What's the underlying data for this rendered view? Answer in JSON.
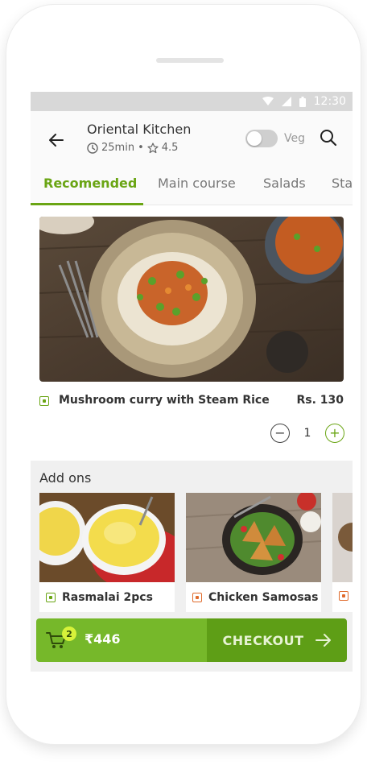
{
  "status_bar": {
    "time": "12:30"
  },
  "header": {
    "restaurant_name": "Oriental Kitchen",
    "delivery_time": "25min",
    "separator": "•",
    "rating": "4.5",
    "veg_toggle_label": "Veg"
  },
  "tabs": [
    {
      "label": "Recomended",
      "active": true
    },
    {
      "label": "Main course",
      "active": false
    },
    {
      "label": "Salads",
      "active": false
    },
    {
      "label": "Starters",
      "active": false
    }
  ],
  "featured_item": {
    "name": "Mushroom curry with Steam Rice",
    "price": "Rs. 130",
    "quantity": "1",
    "minus": "−",
    "plus": "+"
  },
  "addons": {
    "title": "Add ons",
    "items": [
      {
        "name": "Rasmalai 2pcs",
        "type": "veg"
      },
      {
        "name": "Chicken Samosas",
        "type": "non-veg"
      }
    ]
  },
  "cart": {
    "count": "2",
    "total": "₹446",
    "checkout_label": "CHECKOUT"
  },
  "colors": {
    "accent": "#6aa514",
    "cart_left": "#76b82a",
    "cart_right": "#5e9e16",
    "non_veg": "#e06b2c"
  }
}
